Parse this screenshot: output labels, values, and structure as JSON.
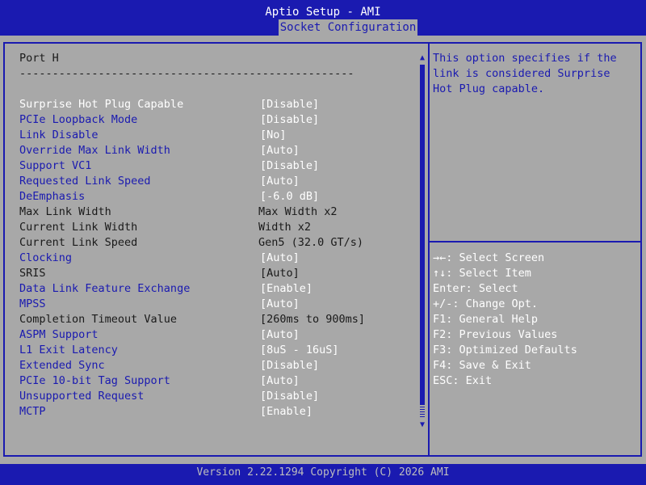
{
  "header": {
    "title": "Aptio Setup - AMI",
    "active_tab": "Socket Configuration"
  },
  "footer": {
    "text": "Version 2.22.1294 Copyright (C) 2026 AMI"
  },
  "section": {
    "title": "Port H",
    "separator": "---------------------------------------------------"
  },
  "settings": [
    {
      "label": "Surprise Hot Plug Capable",
      "value": "[Disable]"
    },
    {
      "label": "PCIe Loopback Mode",
      "value": "[Disable]"
    },
    {
      "label": "Link Disable",
      "value": "[No]"
    },
    {
      "label": "Override Max Link Width",
      "value": "[Auto]"
    },
    {
      "label": "Support VC1",
      "value": "[Disable]"
    },
    {
      "label": "Requested Link Speed",
      "value": "[Auto]"
    },
    {
      "label": "DeEmphasis",
      "value": "[-6.0 dB]"
    },
    {
      "label": "Max Link Width",
      "value": "Max Width x2"
    },
    {
      "label": "Current Link Width",
      "value": "Width x2"
    },
    {
      "label": "Current Link Speed",
      "value": "Gen5 (32.0 GT/s)"
    },
    {
      "label": "Clocking",
      "value": "[Auto]"
    },
    {
      "label": "SRIS",
      "value": "[Auto]"
    },
    {
      "label": "Data Link Feature Exchange",
      "value": "[Enable]"
    },
    {
      "label": "MPSS",
      "value": "[Auto]"
    },
    {
      "label": "Completion Timeout Value",
      "value": "[260ms to 900ms]"
    },
    {
      "label": "ASPM Support",
      "value": "[Auto]"
    },
    {
      "label": "L1 Exit Latency",
      "value": "[8uS - 16uS]"
    },
    {
      "label": "Extended Sync",
      "value": "[Disable]"
    },
    {
      "label": "PCIe 10-bit Tag Support",
      "value": "[Auto]"
    },
    {
      "label": "Unsupported Request",
      "value": "[Disable]"
    },
    {
      "label": "MCTP",
      "value": "[Enable]"
    }
  ],
  "help": {
    "lines": [
      "This option specifies if the",
      "link is considered Surprise",
      "Hot Plug capable."
    ]
  },
  "keys": [
    {
      "key": "→←:",
      "desc": " Select Screen"
    },
    {
      "key": "↑↓:",
      "desc": " Select Item"
    },
    {
      "key": "Enter:",
      "desc": " Select"
    },
    {
      "key": "+/-:",
      "desc": " Change Opt."
    },
    {
      "key": "F1:",
      "desc": " General Help"
    },
    {
      "key": "F2:",
      "desc": " Previous Values"
    },
    {
      "key": "F3:",
      "desc": " Optimized Defaults"
    },
    {
      "key": "F4:",
      "desc": " Save & Exit"
    },
    {
      "key": "ESC:",
      "desc": " Exit"
    }
  ],
  "scroll": {
    "up_icon": "▲",
    "down_icon": "▼"
  }
}
